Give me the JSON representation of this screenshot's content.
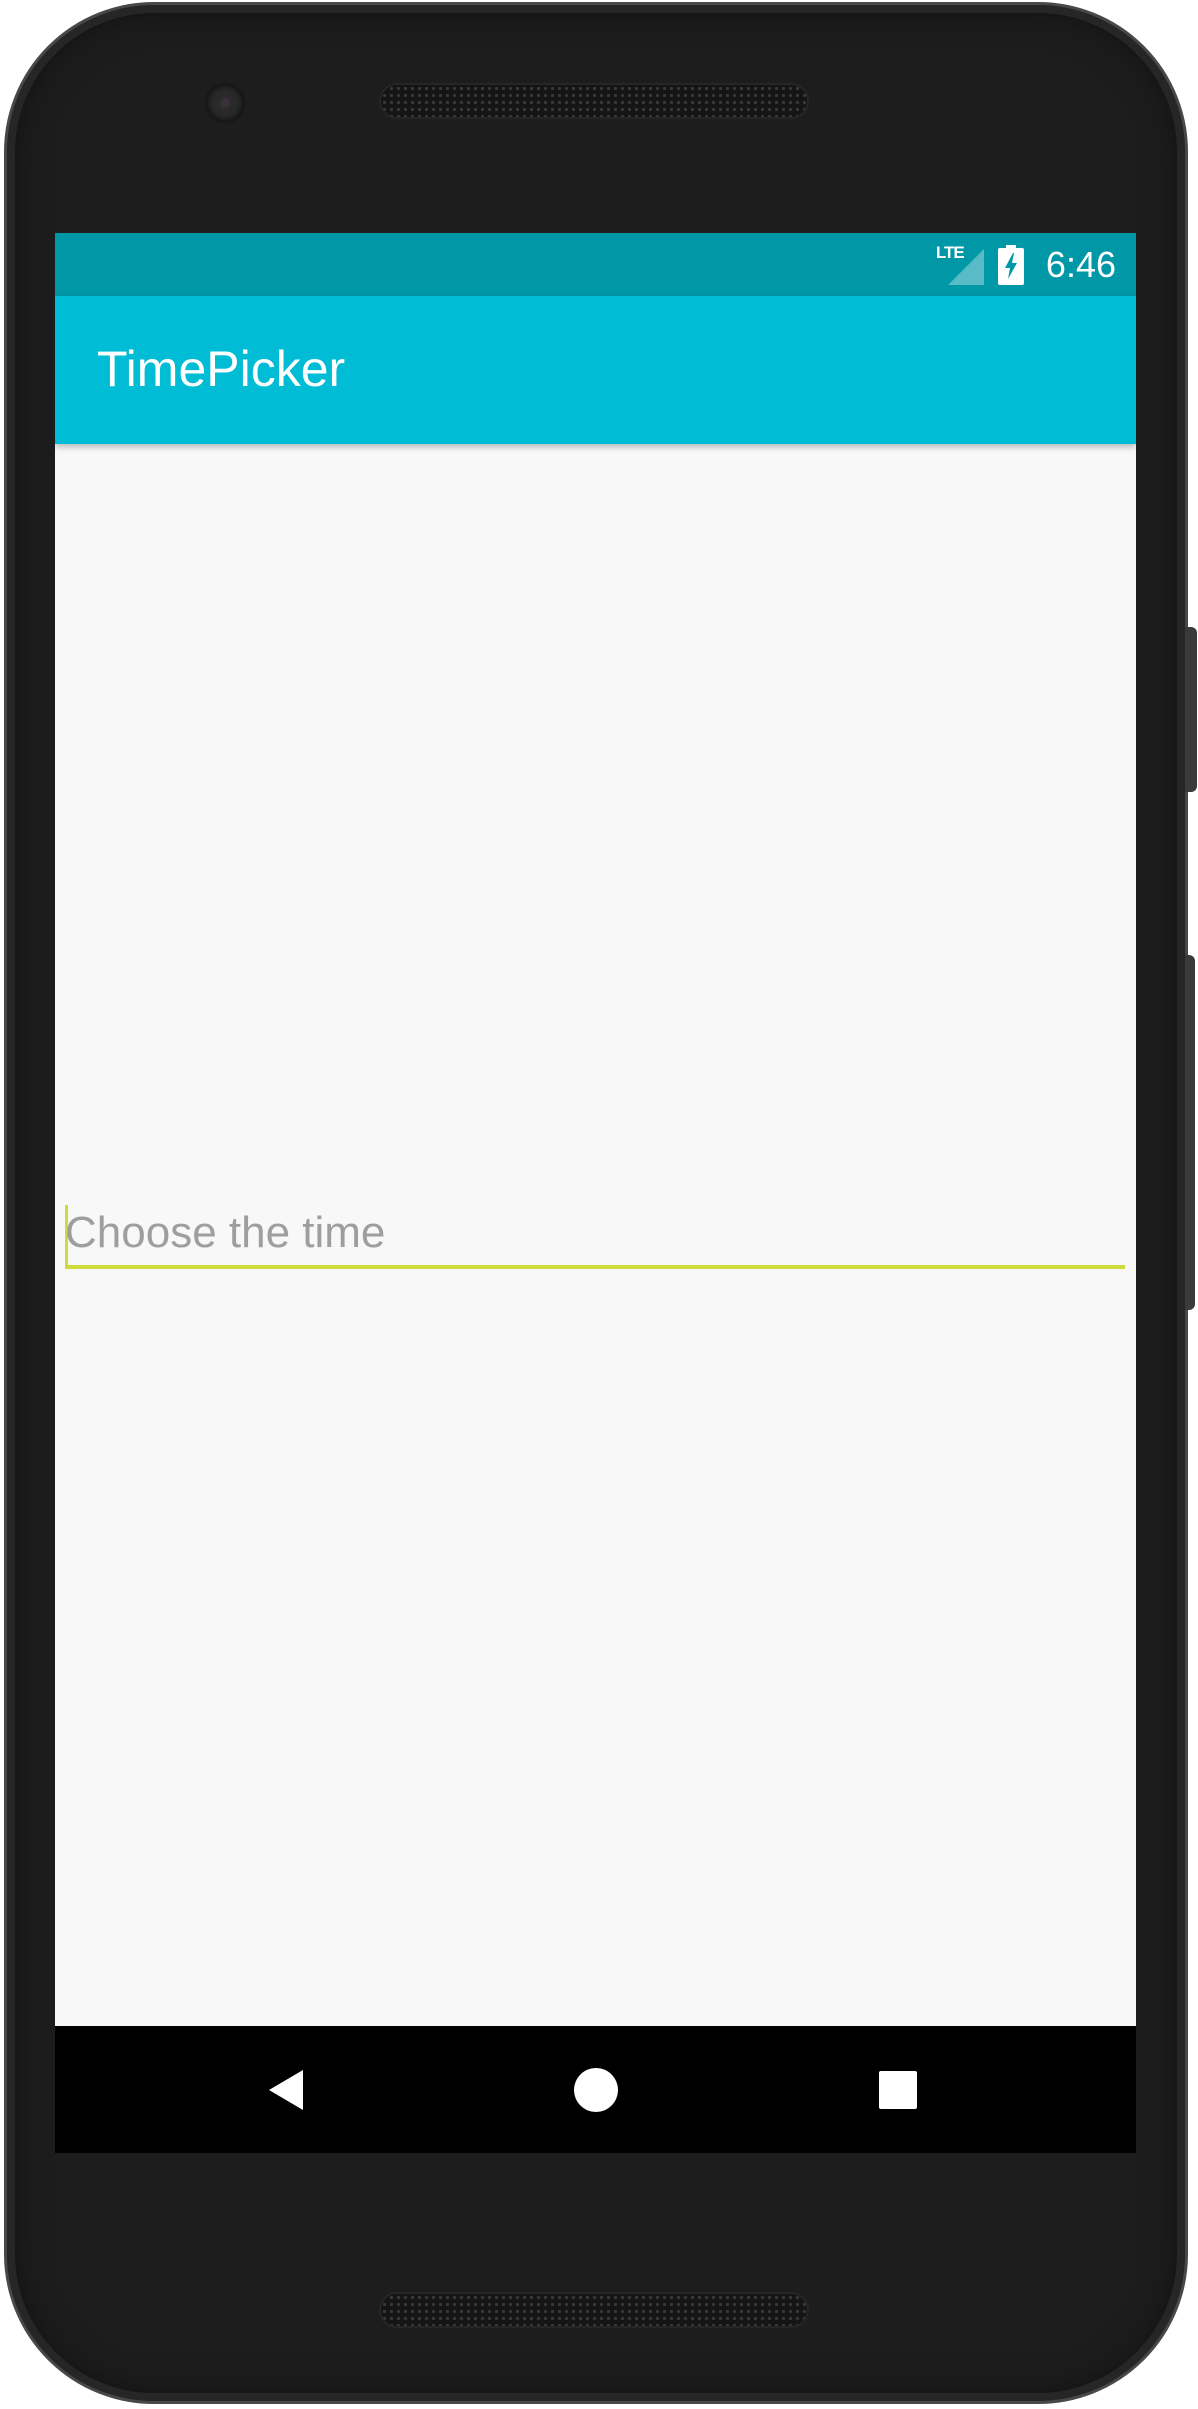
{
  "status_bar": {
    "network": "LTE",
    "time": "6:46",
    "icons": [
      "lte-signal-icon",
      "battery-charging-icon"
    ]
  },
  "app_bar": {
    "title": "TimePicker"
  },
  "time_field": {
    "value": "",
    "placeholder": "Choose the time"
  },
  "nav_bar": {
    "icons": [
      "back-icon",
      "home-icon",
      "recents-icon"
    ]
  },
  "colors": {
    "status_bar": "#0097a7",
    "app_bar": "#00bcd4",
    "accent": "#cddc39",
    "background": "#f8f8f8",
    "nav_bar": "#000000"
  }
}
